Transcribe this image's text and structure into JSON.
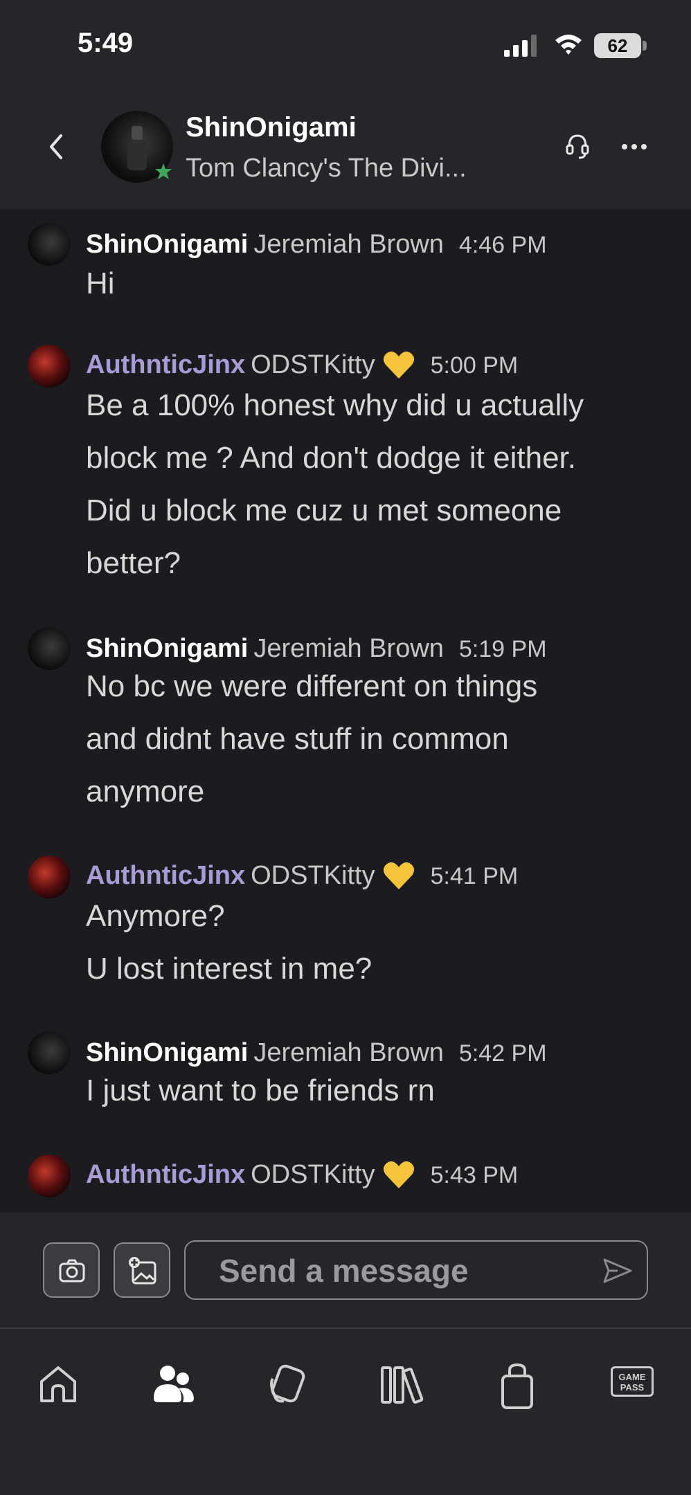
{
  "status_bar": {
    "time": "5:49",
    "battery": "62"
  },
  "header": {
    "name": "ShinOnigami",
    "status": "Tom Clancy's The Divi..."
  },
  "messages": [
    {
      "sender": "ShinOnigami",
      "realname": "Jeremiah Brown",
      "time": "4:46 PM",
      "lines": [
        "Hi"
      ],
      "avatar": "shin"
    },
    {
      "sender": "AuthnticJinx",
      "realname": "ODSTKitty",
      "time": "5:00 PM",
      "lines": [
        "Be a 100% honest why did u actually",
        "block me ? And don't dodge it either.",
        "Did u block me cuz u met someone",
        "better?"
      ],
      "avatar": "jinx"
    },
    {
      "sender": "ShinOnigami",
      "realname": "Jeremiah Brown",
      "time": "5:19 PM",
      "lines": [
        "No bc we were different on things",
        "and didnt have stuff in common",
        "anymore"
      ],
      "avatar": "shin"
    },
    {
      "sender": "AuthnticJinx",
      "realname": "ODSTKitty",
      "time": "5:41 PM",
      "lines": [
        "Anymore?",
        "U lost interest in me?"
      ],
      "avatar": "jinx"
    },
    {
      "sender": "ShinOnigami",
      "realname": "Jeremiah Brown",
      "time": "5:42 PM",
      "lines": [
        "I just want to be friends rn"
      ],
      "avatar": "shin"
    },
    {
      "sender": "AuthnticJinx",
      "realname": "ODSTKitty",
      "time": "5:43 PM",
      "lines": [],
      "avatar": "jinx"
    }
  ],
  "composer": {
    "placeholder": "Send a message"
  },
  "bottom_nav": {
    "items": [
      "home-icon",
      "friends-icon",
      "cards-icon",
      "library-icon",
      "store-icon",
      "game-pass-icon"
    ],
    "game_pass_label_1": "GAME",
    "game_pass_label_2": "PASS"
  },
  "colors": {
    "background": "#1c1c20",
    "header_bg": "#26262a",
    "jinx_name": "#a99bd6",
    "presence": "#3fa55b",
    "heart": "#f5c43a"
  }
}
